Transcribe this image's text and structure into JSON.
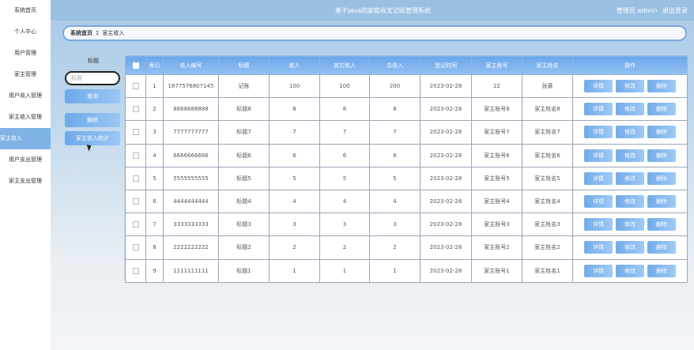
{
  "header": {
    "site_title": "基于Java的家庭收支记账管理系统",
    "user_label": "管理员 admin",
    "logout": "退出登录"
  },
  "sidebar": {
    "items": [
      {
        "label": "系统首页"
      },
      {
        "label": "个人中心"
      },
      {
        "label": "用户管理"
      },
      {
        "label": "家主管理"
      },
      {
        "label": "用户收入管理"
      },
      {
        "label": "家主收入管理"
      },
      {
        "label": "家主收入",
        "active": true
      },
      {
        "label": "用户支出管理"
      },
      {
        "label": "家主支出管理"
      }
    ]
  },
  "breadcrumb": {
    "home": "系统首页",
    "separator": "Σ",
    "current": "家主收入"
  },
  "search": {
    "label": "标题",
    "placeholder": "标题",
    "query_button": "查询",
    "delete_button": "删除",
    "stats_button": "家主收入统计"
  },
  "table": {
    "headers": [
      "",
      "索引",
      "收入编号",
      "标题",
      "收入",
      "其它收入",
      "总收入",
      "登记时间",
      "家主账号",
      "家主姓名",
      "操作"
    ],
    "actions": {
      "detail": "详情",
      "edit": "修改",
      "delete": "删除"
    },
    "rows": [
      {
        "index": "1",
        "code": "1677576807145",
        "title": "记账",
        "income": "100",
        "other": "100",
        "total": "200",
        "date": "2023-02-28",
        "account": "22",
        "name": "张黄"
      },
      {
        "index": "2",
        "code": "8888888888",
        "title": "标题8",
        "income": "8",
        "other": "8",
        "total": "8",
        "date": "2023-02-28",
        "account": "家主账号8",
        "name": "家主姓名8"
      },
      {
        "index": "3",
        "code": "7777777777",
        "title": "标题7",
        "income": "7",
        "other": "7",
        "total": "7",
        "date": "2023-02-28",
        "account": "家主账号7",
        "name": "家主姓名7"
      },
      {
        "index": "4",
        "code": "6666666666",
        "title": "标题6",
        "income": "6",
        "other": "6",
        "total": "6",
        "date": "2023-02-28",
        "account": "家主账号6",
        "name": "家主姓名6"
      },
      {
        "index": "5",
        "code": "5555555555",
        "title": "标题5",
        "income": "5",
        "other": "5",
        "total": "5",
        "date": "2023-02-28",
        "account": "家主账号5",
        "name": "家主姓名5"
      },
      {
        "index": "6",
        "code": "4444444444",
        "title": "标题4",
        "income": "4",
        "other": "4",
        "total": "4",
        "date": "2023-02-28",
        "account": "家主账号4",
        "name": "家主姓名4"
      },
      {
        "index": "7",
        "code": "3333333333",
        "title": "标题3",
        "income": "3",
        "other": "3",
        "total": "3",
        "date": "2023-02-28",
        "account": "家主账号3",
        "name": "家主姓名3"
      },
      {
        "index": "8",
        "code": "2222222222",
        "title": "标题2",
        "income": "2",
        "other": "2",
        "total": "2",
        "date": "2023-02-28",
        "account": "家主账号2",
        "name": "家主姓名2"
      },
      {
        "index": "9",
        "code": "1111111111",
        "title": "标题1",
        "income": "1",
        "other": "1",
        "total": "1",
        "date": "2023-02-28",
        "account": "家主账号1",
        "name": "家主姓名1"
      }
    ]
  }
}
